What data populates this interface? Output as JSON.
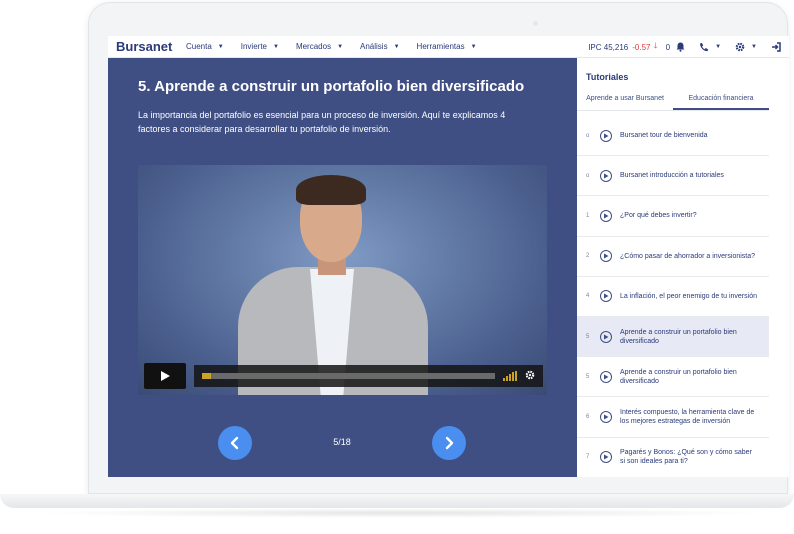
{
  "app": {
    "name": "Bursanet"
  },
  "nav": {
    "items": [
      {
        "label": "Cuenta"
      },
      {
        "label": "Invierte"
      },
      {
        "label": "Mercados"
      },
      {
        "label": "Análisis"
      },
      {
        "label": "Herramientas"
      }
    ],
    "ipc_label": "IPC",
    "ipc_value": "45,216",
    "ipc_change": "-0.57",
    "notifications": "0"
  },
  "lesson": {
    "title": "5. Aprende a construir un portafolio bien diversificado",
    "description": "La importancia del portafolio es esencial para un proceso de inversión. Aquí te explicamos 4 factores a considerar para desarrollar tu portafolio de inversión.",
    "video_progress": 0.03
  },
  "pager": {
    "label": "5/18"
  },
  "sidebar": {
    "heading": "Tutoriales",
    "tabs": [
      {
        "label": "Aprende a usar Bursanet"
      },
      {
        "label": "Educación financiera"
      }
    ],
    "lessons": [
      {
        "num": "o",
        "label": "Bursanet tour de bienvenida"
      },
      {
        "num": "o",
        "label": "Bursanet introducción a tutoriales"
      },
      {
        "num": "1",
        "label": "¿Por qué debes invertir?"
      },
      {
        "num": "2",
        "label": "¿Cómo pasar de ahorrador a inversionista?"
      },
      {
        "num": "4",
        "label": "La inflación, el peor enemigo de tu inversión"
      },
      {
        "num": "5",
        "label": "Aprende a construir un portafolio bien diversificado"
      },
      {
        "num": "5",
        "label": "Aprende a construir un portafolio bien diversificado"
      },
      {
        "num": "6",
        "label": "Interés compuesto, la herramienta clave de los mejores estrategas de inversión"
      },
      {
        "num": "7",
        "label": "Pagarés y Bonos: ¿Qué son y cómo saber si son ideales para ti?"
      }
    ]
  },
  "colors": {
    "brand": "#2a3a7a",
    "video_panel": "#3f4f84",
    "nav_button": "#4a8ef0",
    "negative": "#e53935",
    "progress": "#c9a227"
  }
}
